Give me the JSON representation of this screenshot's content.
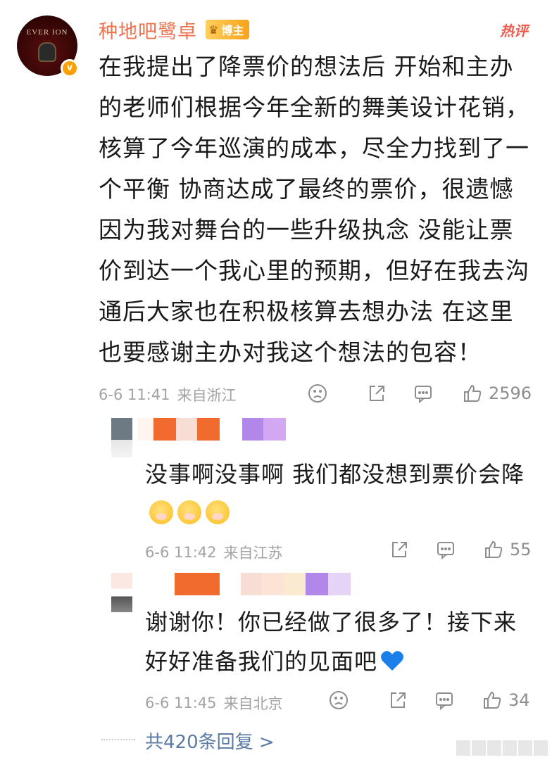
{
  "post": {
    "user_name": "种地吧鹭卓",
    "badge_label": "博主",
    "hot_tag": "热评",
    "avatar_text": "EVER ION",
    "content": "在我提出了降票价的想法后 开始和主办的老师们根据今年全新的舞美设计花销，核算了今年巡演的成本，尽全力找到了一个平衡 协商达成了最终的票价，很遗憾因为我对舞台的一些升级执念 没能让票价到达一个我心里的预期，但好在我去沟通后大家也在积极核算去想办法 在这里也要感谢主办对我这个想法的包容！",
    "time": "6-6 11:41",
    "location": "来自浙江",
    "likes": "2596"
  },
  "replies": [
    {
      "text": "没事啊没事啊  我们都没想到票价会降",
      "time": "6-6 11:42",
      "location": "来自江苏",
      "likes": "55"
    },
    {
      "text": "谢谢你！你已经做了很多了！接下来好好准备我们的见面吧",
      "time": "6-6 11:45",
      "location": "来自北京",
      "likes": "34"
    }
  ],
  "footer": {
    "total_replies": "共420条回复 >"
  },
  "icons": {
    "dislike": "frown-face-icon",
    "share": "share-icon",
    "comment": "comment-icon",
    "like": "thumbs-up-icon"
  },
  "colors": {
    "username": "#eb7350",
    "hot_tag": "#f15b4e",
    "link": "#5b7aa6",
    "meta": "#a3a3a3"
  }
}
